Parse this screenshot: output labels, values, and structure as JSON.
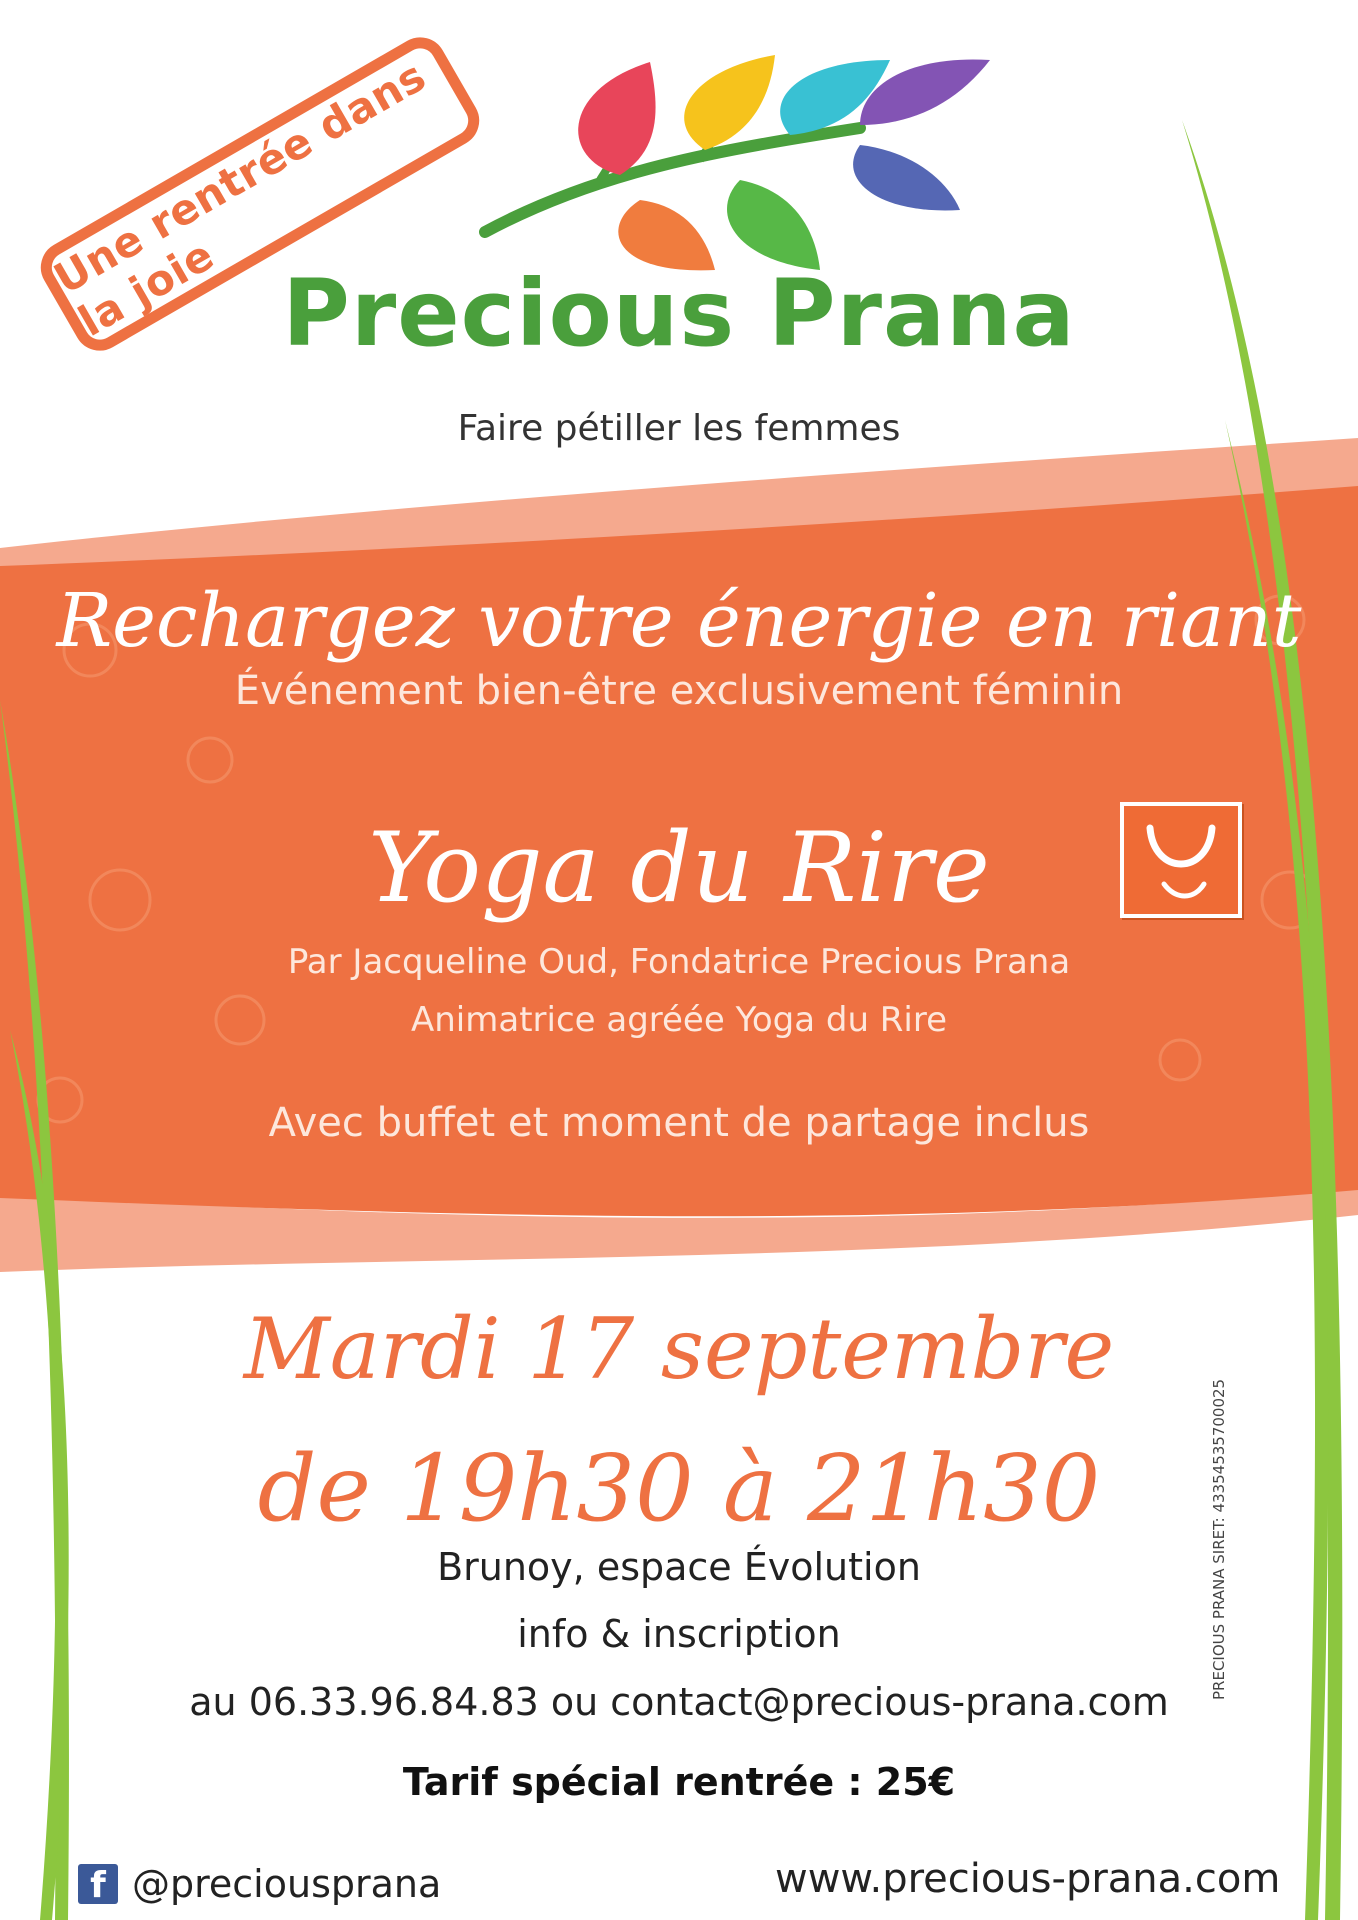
{
  "stamp": {
    "text": "Une rentrée dans la joie"
  },
  "brand": {
    "name": "Precious Prana",
    "tagline": "Faire pétiller les femmes"
  },
  "banner": {
    "headline": "Rechargez votre énergie en riant",
    "subhead": "Événement bien-être exclusivement féminin",
    "title": "Yoga du Rire",
    "byline": "Par Jacqueline Oud, Fondatrice Precious Prana",
    "role": "Animatrice agréée Yoga du Rire",
    "buffet": "Avec buffet et moment de partage inclus"
  },
  "event": {
    "date": "Mardi 17 septembre",
    "time": "de 19h30 à 21h30",
    "place": "Brunoy, espace Évolution",
    "info": "info & inscription",
    "contact": "au 06.33.96.84.83 ou contact@precious-prana.com",
    "price": "Tarif spécial rentrée : 25€"
  },
  "footer": {
    "social_icon": "facebook-icon",
    "social_icon_glyph": "f",
    "social_handle": "@preciousprana",
    "website": "www.precious-prana.com",
    "siret": "PRECIOUS PRANA  SIRET: 43354535700025"
  },
  "colors": {
    "orange": "#ee7142",
    "salmon": "#f5a98e",
    "green": "#4a9f3c",
    "grass": "#8cc63f",
    "leaf_red": "#e8455a",
    "leaf_yellow": "#f6c31c",
    "leaf_cyan": "#39c1d3",
    "leaf_purple": "#8354b4",
    "leaf_orange": "#f07c3e",
    "leaf_green": "#57b847",
    "leaf_blue": "#5567b4"
  }
}
